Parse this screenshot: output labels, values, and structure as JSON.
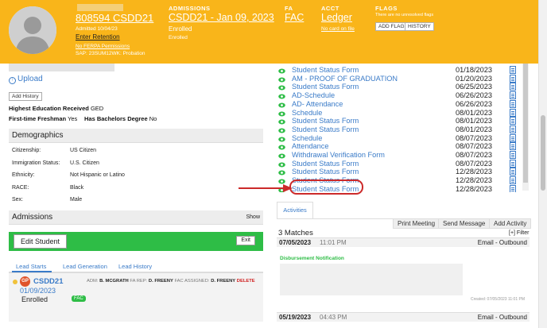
{
  "header": {
    "student_id_name": "808594 CSDD21",
    "admitted": "Admitted 10/04/23",
    "retention": "Enter Retention",
    "ferpa": "No FERPA Permissions",
    "sap": "SAP: 23SUM12WK: Probation",
    "admissions_label": "ADMISSIONS",
    "admissions_value": "CSDD21 - Jan 09, 2023",
    "admissions_status": "Enrolled",
    "admissions_sub": "Enrolled",
    "fa_label": "FA",
    "fa_value": "FAC",
    "acct_label": "ACCT",
    "acct_value": "Ledger",
    "acct_sub": "No card on file",
    "flags_label": "FLAGS",
    "flags_sub": "There are no unresolved flags",
    "add_flag": "ADD FLAG",
    "history": "HISTORY"
  },
  "left": {
    "upload": "Upload",
    "add_history": "Add History",
    "highest_edu_label": "Highest Education Received",
    "highest_edu_value": "GED",
    "first_time_label": "First-time Freshman",
    "first_time_value": "Yes",
    "bachelors_label": "Has Bachelors Degree",
    "bachelors_value": "No",
    "demographics_title": "Demographics",
    "demographics": [
      {
        "k": "Citizenship:",
        "v": "US Citizen"
      },
      {
        "k": "Immigration Status:",
        "v": "U.S. Citizen"
      },
      {
        "k": "Ethnicity:",
        "v": "Not Hispanic or Latino"
      },
      {
        "k": "RACE:",
        "v": "Black"
      },
      {
        "k": "Sex:",
        "v": "Male"
      }
    ],
    "admissions_title": "Admissions",
    "admissions_show": "Show",
    "edit_student": "Edit Student",
    "exit": "Exit",
    "tabs": [
      "Lead Starts",
      "Lead Generation",
      "Lead History"
    ],
    "lead": {
      "badge": "GP",
      "code": "CSDD21",
      "date": "01/09/2023",
      "status": "Enrolled",
      "fac_badge": "FAC",
      "adm_label": "ADM:",
      "adm_value": "B. MCGRATH",
      "farep_label": "FA REP:",
      "farep_value": "D. FREENY",
      "facassigned_label": "FAC ASSIGNED:",
      "facassigned_value": "D. FREENY",
      "delete": "DELETE"
    }
  },
  "forms": [
    {
      "name": "Student Status Form",
      "date": "01/18/2023"
    },
    {
      "name": "AM - PROOF OF GRADUATION",
      "date": "01/20/2023"
    },
    {
      "name": "Student Status Form",
      "date": "06/25/2023"
    },
    {
      "name": "AD-Schedule",
      "date": "06/26/2023"
    },
    {
      "name": "AD- Attendance",
      "date": "06/26/2023"
    },
    {
      "name": "Schedule",
      "date": "08/01/2023"
    },
    {
      "name": "Student Status Form",
      "date": "08/01/2023"
    },
    {
      "name": "Student Status Form",
      "date": "08/01/2023"
    },
    {
      "name": "Schedule",
      "date": "08/07/2023"
    },
    {
      "name": "Attendance",
      "date": "08/07/2023"
    },
    {
      "name": "Withdrawal Verification Form",
      "date": "08/07/2023"
    },
    {
      "name": "Student Status Form",
      "date": "08/07/2023"
    },
    {
      "name": "Student Status Form",
      "date": "12/28/2023"
    },
    {
      "name": "Student Status Form",
      "date": "12/28/2023"
    },
    {
      "name": "Student Status Form",
      "date": "12/28/2023"
    }
  ],
  "activities": {
    "tab": "Activities",
    "print_meeting": "Print Meeting",
    "send_message": "Send Message",
    "add_activity": "Add Activity",
    "matches": "3 Matches",
    "filter": "[+] Filter",
    "item1": {
      "date": "07/05/2023",
      "time": "11:01 PM",
      "type": "Email - Outbound"
    },
    "notification": "Disbursement Notification",
    "created": "Created: 07/05/2023 11:01 PM",
    "item2": {
      "date": "05/19/2023",
      "time": "04:43 PM",
      "type": "Email - Outbound"
    }
  }
}
